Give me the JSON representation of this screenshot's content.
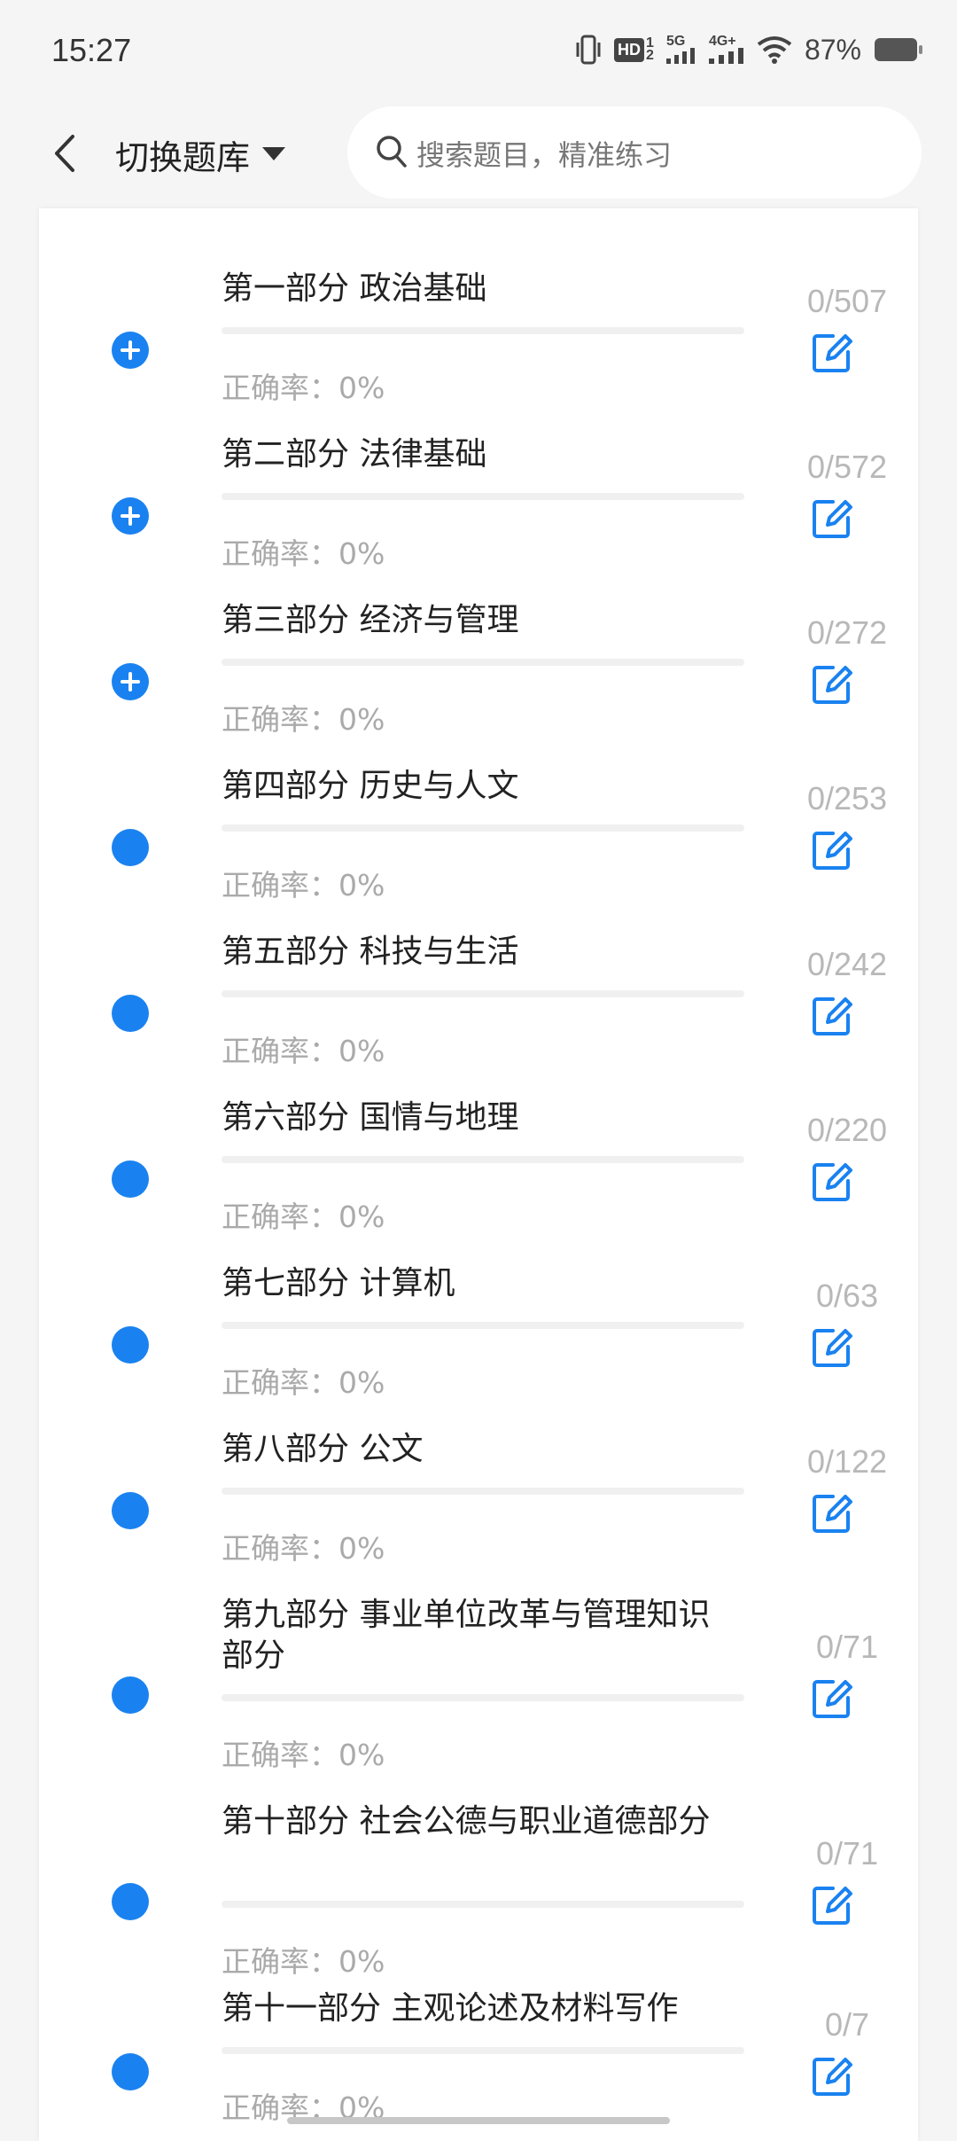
{
  "status_bar": {
    "time": "15:27",
    "hd_label": "HD",
    "sim_sup": "1",
    "sim_sub": "2",
    "net1": "5G",
    "net2": "4G+",
    "battery": "87%"
  },
  "header": {
    "bank_title": "切换题库",
    "search_placeholder": "搜索题目，精准练习"
  },
  "sections": [
    {
      "title": "第一部分 政治基础",
      "accuracy": "正确率：0%",
      "count": "0/507",
      "expandable": true
    },
    {
      "title": "第二部分 法律基础",
      "accuracy": "正确率：0%",
      "count": "0/572",
      "expandable": true
    },
    {
      "title": "第三部分 经济与管理",
      "accuracy": "正确率：0%",
      "count": "0/272",
      "expandable": true
    },
    {
      "title": "第四部分 历史与人文",
      "accuracy": "正确率：0%",
      "count": "0/253",
      "expandable": false
    },
    {
      "title": "第五部分 科技与生活",
      "accuracy": "正确率：0%",
      "count": "0/242",
      "expandable": false
    },
    {
      "title": "第六部分 国情与地理",
      "accuracy": "正确率：0%",
      "count": "0/220",
      "expandable": false
    },
    {
      "title": "第七部分 计算机",
      "accuracy": "正确率：0%",
      "count": "0/63",
      "expandable": false
    },
    {
      "title": "第八部分 公文",
      "accuracy": "正确率：0%",
      "count": "0/122",
      "expandable": false
    },
    {
      "title": "第九部分 事业单位改革与管理知识部分",
      "accuracy": "正确率：0%",
      "count": "0/71",
      "expandable": false
    },
    {
      "title": "第十部分 社会公德与职业道德部分",
      "accuracy": "正确率：0%",
      "count": "0/71",
      "expandable": false
    },
    {
      "title": "第十一部分 主观论述及材料写作",
      "accuracy": "正确率：0%",
      "count": "0/7",
      "expandable": false
    }
  ],
  "colors": {
    "accent": "#1a82f0",
    "count_text": "#b8b8b8",
    "accuracy_text": "#aaaaaa"
  }
}
